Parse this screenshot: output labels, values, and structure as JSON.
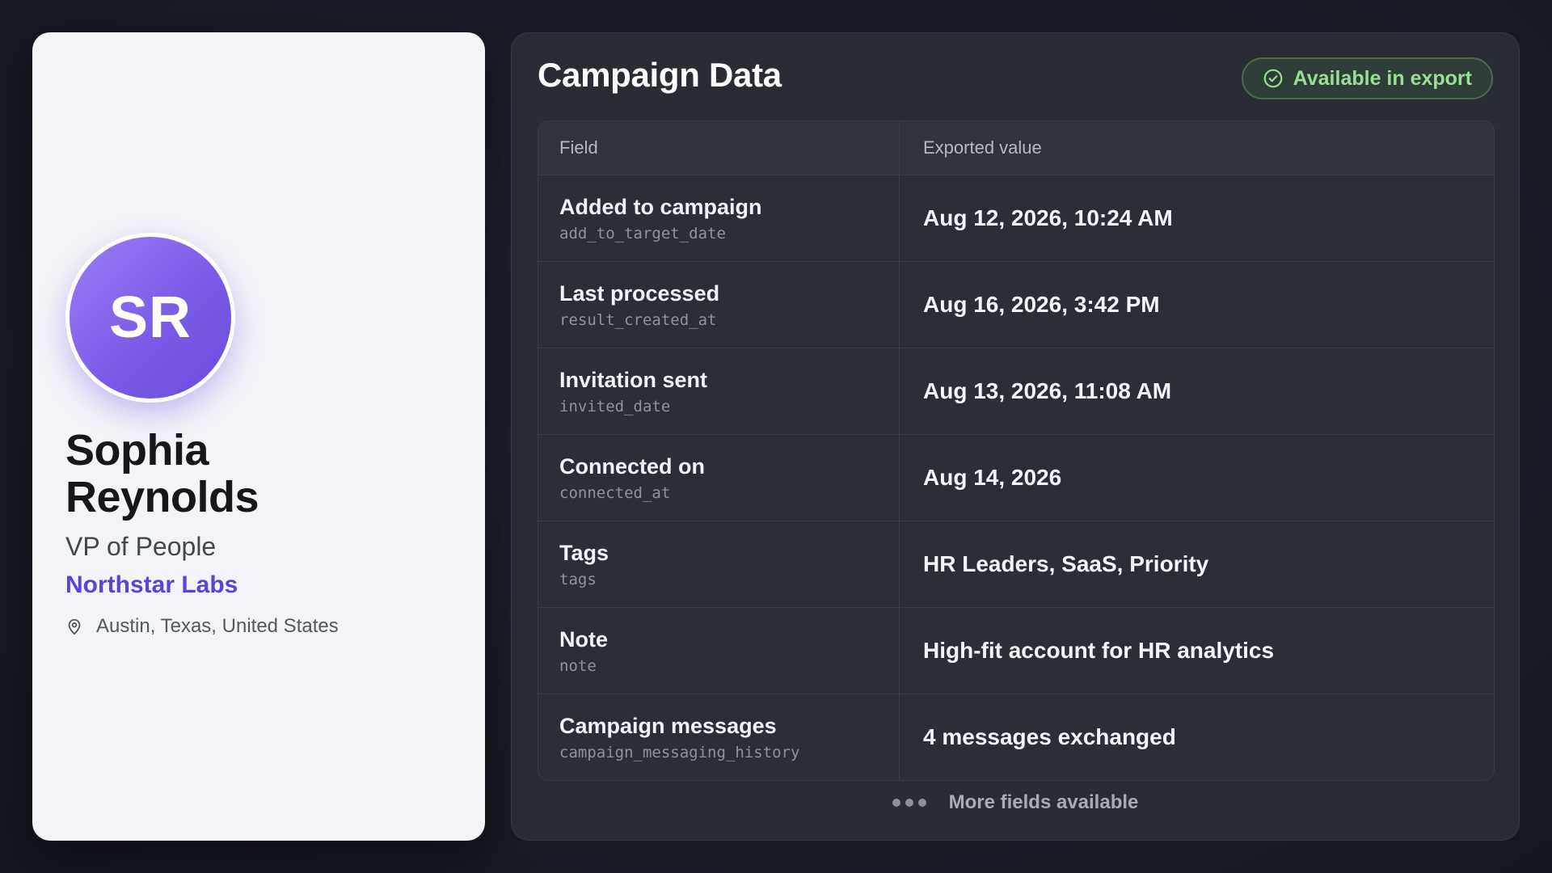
{
  "profile": {
    "initials": "SR",
    "name": "Sophia Reynolds",
    "title": "VP of People",
    "company": "Northstar Labs",
    "location": "Austin, Texas, United States"
  },
  "campaign": {
    "title": "Campaign Data",
    "badge_label": "Available in export",
    "columns": {
      "field": "Field",
      "value": "Exported value"
    },
    "rows": [
      {
        "label": "Added to campaign",
        "key": "add_to_target_date",
        "value": "Aug 12, 2026, 10:24 AM"
      },
      {
        "label": "Last processed",
        "key": "result_created_at",
        "value": "Aug 16, 2026, 3:42 PM"
      },
      {
        "label": "Invitation sent",
        "key": "invited_date",
        "value": "Aug 13, 2026, 11:08 AM"
      },
      {
        "label": "Connected on",
        "key": "connected_at",
        "value": "Aug 14, 2026"
      },
      {
        "label": "Tags",
        "key": "tags",
        "value": "HR Leaders, SaaS, Priority"
      },
      {
        "label": "Note",
        "key": "note",
        "value": "High-fit account for HR analytics"
      },
      {
        "label": "Campaign messages",
        "key": "campaign_messaging_history",
        "value": "4 messages exchanged"
      }
    ],
    "more_label": "More fields available"
  },
  "colors": {
    "accent": "#5a43d6",
    "avatar_gradient_start": "#9b7cf5",
    "avatar_gradient_end": "#6a4ad9",
    "badge_text": "#9bdc96"
  },
  "icons": {
    "location": "map-pin-icon",
    "badge": "check-circle-icon",
    "more": "more-dots-icon"
  }
}
